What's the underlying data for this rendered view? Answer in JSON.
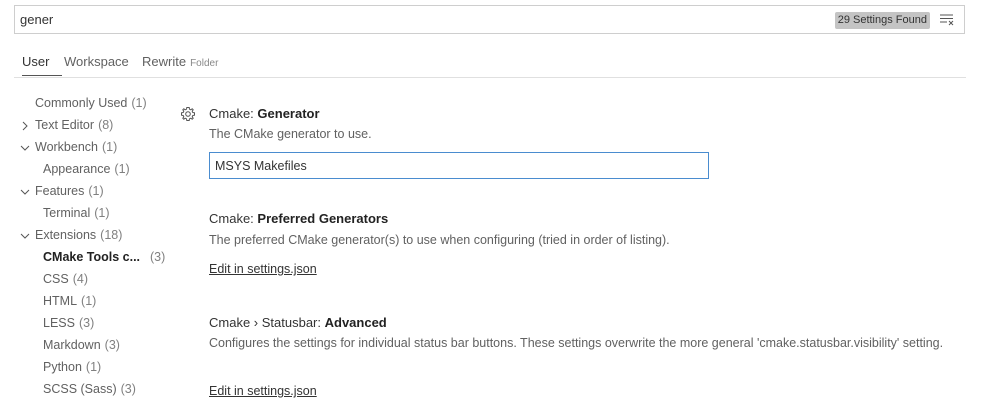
{
  "search": {
    "value": "gener",
    "results_badge": "29 Settings Found"
  },
  "tabs": [
    {
      "label": "User"
    },
    {
      "label": "Workspace"
    },
    {
      "label": "Rewrite",
      "sublabel": "Folder"
    }
  ],
  "tree": [
    {
      "label": "Commonly Used",
      "count": "(1)"
    },
    {
      "label": "Text Editor",
      "count": "(8)"
    },
    {
      "label": "Workbench",
      "count": "(1)"
    },
    {
      "label": "Appearance",
      "count": "(1)"
    },
    {
      "label": "Features",
      "count": "(1)"
    },
    {
      "label": "Terminal",
      "count": "(1)"
    },
    {
      "label": "Extensions",
      "count": "(18)"
    },
    {
      "label": "CMake Tools c...",
      "count": "(3)"
    },
    {
      "label": "CSS",
      "count": "(4)"
    },
    {
      "label": "HTML",
      "count": "(1)"
    },
    {
      "label": "LESS",
      "count": "(3)"
    },
    {
      "label": "Markdown",
      "count": "(3)"
    },
    {
      "label": "Python",
      "count": "(1)"
    },
    {
      "label": "SCSS (Sass)",
      "count": "(3)"
    }
  ],
  "settings": [
    {
      "prefix": "Cmake: ",
      "name": "Generator",
      "description": "The CMake generator to use.",
      "value": "MSYS Makefiles"
    },
    {
      "prefix": "Cmake: ",
      "name": "Preferred Generators",
      "description": "The preferred CMake generator(s) to use when configuring (tried in order of listing).",
      "link": "Edit in settings.json"
    },
    {
      "prefix": "Cmake › Statusbar: ",
      "name": "Advanced",
      "description": "Configures the settings for individual status bar buttons. These settings overwrite the more general 'cmake.statusbar.visibility' setting.",
      "link": "Edit in settings.json"
    }
  ]
}
